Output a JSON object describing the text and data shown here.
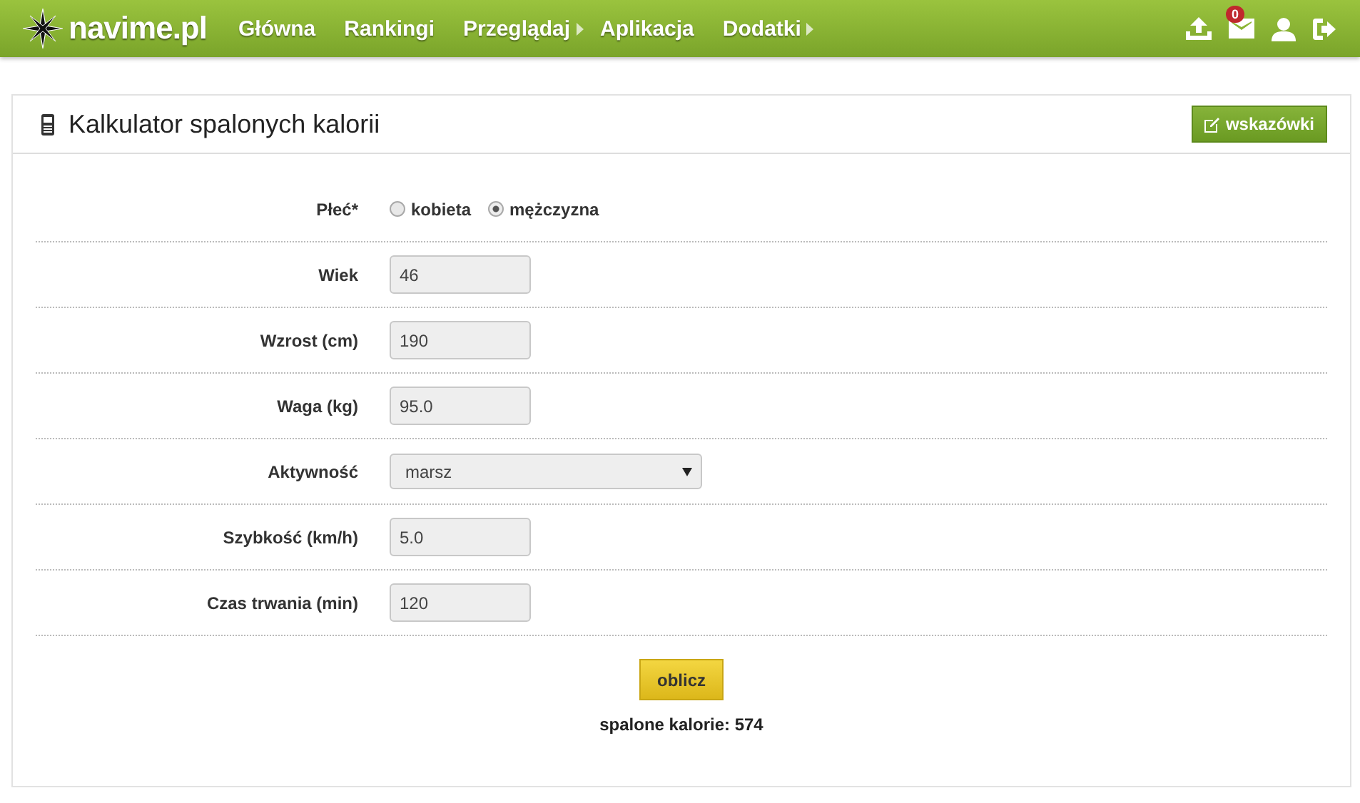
{
  "navbar": {
    "logo": "navime.pl",
    "items": [
      {
        "label": "Główna",
        "submenu": false
      },
      {
        "label": "Rankingi",
        "submenu": false
      },
      {
        "label": "Przeglądaj",
        "submenu": true
      },
      {
        "label": "Aplikacja",
        "submenu": false
      },
      {
        "label": "Dodatki",
        "submenu": true
      }
    ],
    "mail_badge": "0"
  },
  "panel": {
    "title": "Kalkulator spalonych kalorii",
    "hint_button": "wskazówki"
  },
  "fields": [
    {
      "kind": "radio",
      "label": "Płeć*",
      "options": [
        {
          "label": "kobieta",
          "selected": false
        },
        {
          "label": "mężczyzna",
          "selected": true
        }
      ]
    },
    {
      "kind": "text",
      "label": "Wiek",
      "value": "46"
    },
    {
      "kind": "text",
      "label": "Wzrost (cm)",
      "value": "190"
    },
    {
      "kind": "text",
      "label": "Waga (kg)",
      "value": "95.0"
    },
    {
      "kind": "select",
      "label": "Aktywność",
      "value": "marsz"
    },
    {
      "kind": "text",
      "label": "Szybkość (km/h)",
      "value": "5.0"
    },
    {
      "kind": "text",
      "label": "Czas trwania (min)",
      "value": "120"
    }
  ],
  "submit": "oblicz",
  "result": "spalone kalorie: 574"
}
